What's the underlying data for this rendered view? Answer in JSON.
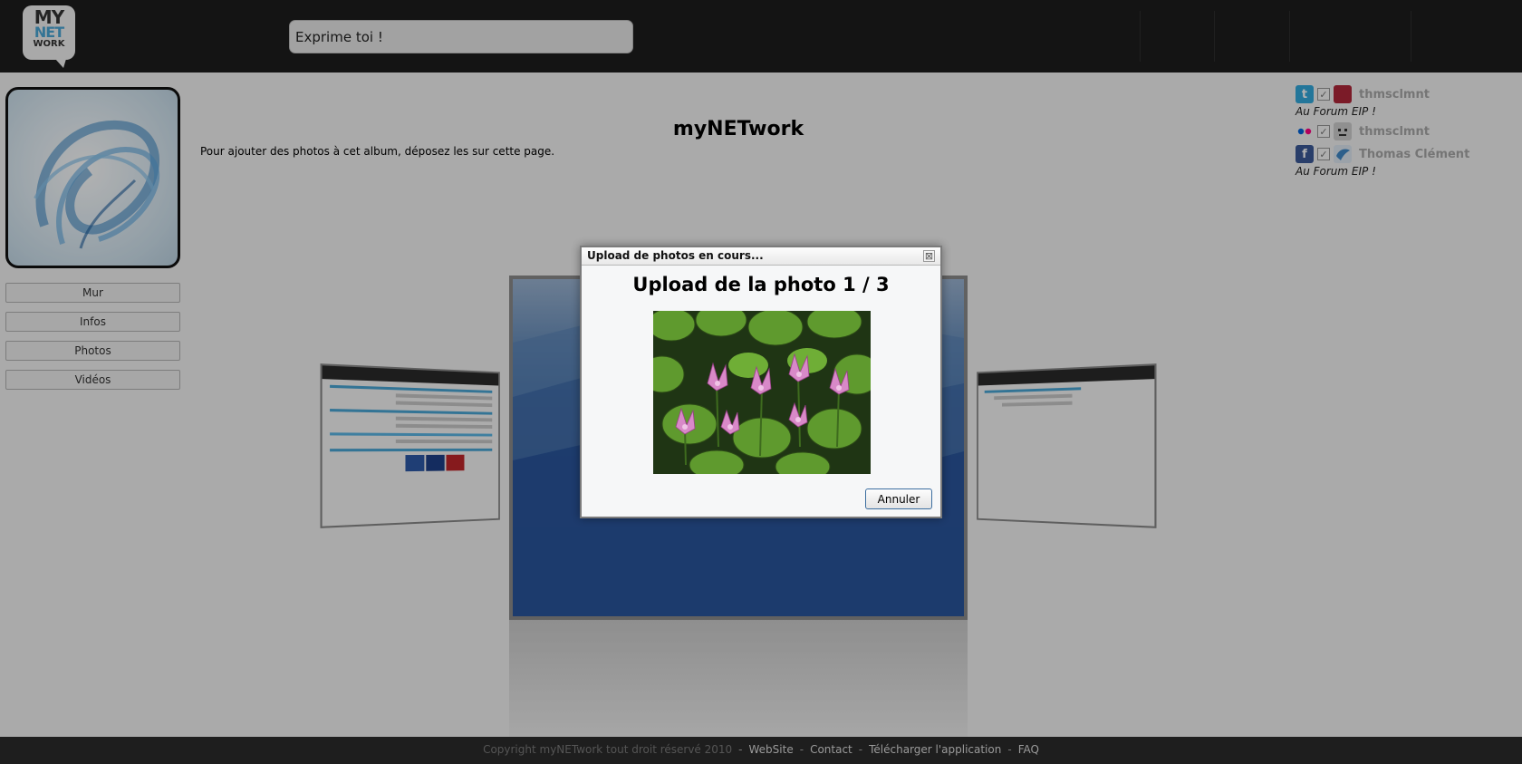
{
  "header": {
    "logo": {
      "line1": "MY",
      "line2": "NET",
      "line3": "WORK"
    },
    "status_input": {
      "placeholder": "Exprime toi !"
    }
  },
  "sidebar": {
    "nav": [
      {
        "label": "Mur"
      },
      {
        "label": "Infos"
      },
      {
        "label": "Photos"
      },
      {
        "label": "Vidéos"
      }
    ]
  },
  "main": {
    "title": "myNETwork",
    "instructions": "Pour ajouter des photos à cet album, déposez les sur cette page."
  },
  "social": {
    "accounts": [
      {
        "service": "twitter-icon",
        "glyph": "t",
        "color": "#33aadd",
        "checked": true,
        "avatar_color": "#b0283a",
        "name": "thmsclmnt",
        "status": "Au Forum EIP !"
      },
      {
        "service": "flickr-icon",
        "glyph": "",
        "color": "#f4f4f4",
        "checked": true,
        "avatar_color": "#cfcfcf",
        "name": "thmsclmnt",
        "status": ""
      },
      {
        "service": "facebook-icon",
        "glyph": "f",
        "color": "#3b5998",
        "checked": true,
        "avatar_color": "#3f89c7",
        "name": "Thomas Clément",
        "status": "Au Forum EIP !"
      }
    ],
    "check_glyph": "✓"
  },
  "dialog": {
    "title": "Upload de photos en cours...",
    "close_glyph": "⊠",
    "heading": "Upload de la photo 1 / 3",
    "cancel_label": "Annuler"
  },
  "footer": {
    "copyright": "Copyright myNETwork tout droit réservé 2010",
    "separator": "-",
    "links": [
      "WebSite",
      "Contact",
      "Télécharger l'application",
      "FAQ"
    ]
  },
  "colors": {
    "header_bg": "#1e1e1e",
    "accent": "#4aa6d6",
    "dialog_button_border": "#3c6ea0"
  }
}
